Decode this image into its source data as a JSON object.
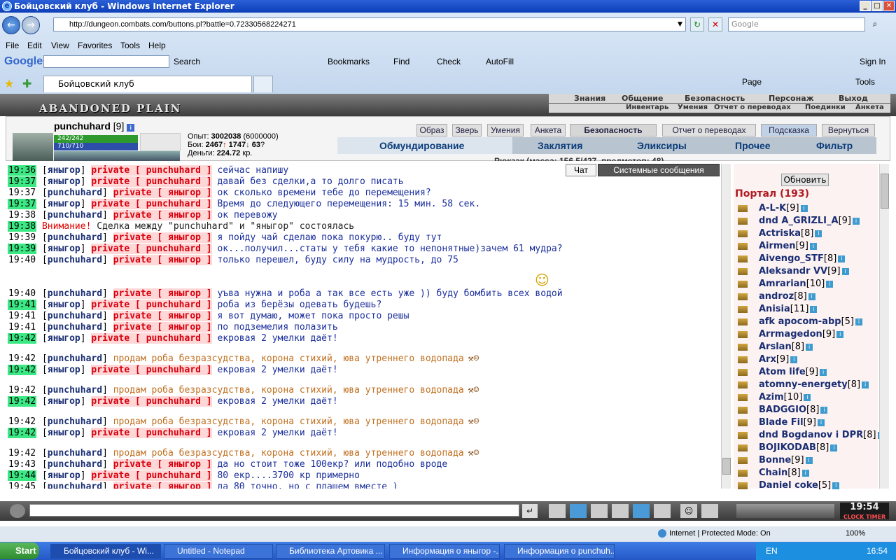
{
  "window": {
    "title": "Бойцовский клуб - Windows Internet Explorer"
  },
  "browser": {
    "address": "http://dungeon.combats.com/buttons.pl?battle=0.72330568224271",
    "search_placeholder": "Google",
    "menu": [
      "File",
      "Edit",
      "View",
      "Favorites",
      "Tools",
      "Help"
    ],
    "google_toolbar": {
      "logo": "Google",
      "search_label": "Search",
      "bookmarks": "Bookmarks",
      "find": "Find",
      "check": "Check",
      "autofill": "AutoFill",
      "signin": "Sign In"
    },
    "tab_title": "Бойцовский клуб",
    "cmd": {
      "page": "Page",
      "tools": "Tools"
    }
  },
  "game": {
    "location": "ABANDONED PLAIN",
    "top_nav1": [
      "Знания",
      "Общение",
      "Безопасность",
      "Персонаж",
      "Выход"
    ],
    "top_nav2": [
      "Инвентарь",
      "Умения",
      "Отчет о переводах",
      "Поединки",
      "Анкета"
    ],
    "character": {
      "name": "punchuhard",
      "level": "[9]",
      "hp": "242/242",
      "mana": "710/710"
    },
    "stats": {
      "exp_label": "Опыт:",
      "exp": "3002038",
      "exp_next": "(6000000)",
      "fights_label": "Бои:",
      "wins": "2467",
      "losses": "1747",
      "draws": "63",
      "money_label": "Деньги:",
      "money": "224.72",
      "money_unit": "кр."
    },
    "buttons": [
      "Образ",
      "Зверь",
      "Умения",
      "Анкета",
      "Безопасность",
      "Отчет о переводах",
      "Подсказка",
      "Вернуться"
    ],
    "inv_tabs": [
      "Обмундирование",
      "Заклятия",
      "Эликсиры",
      "Прочее",
      "Фильтр"
    ],
    "backpack": "Рюкзак (масса: 156.5/427, предметов: 48)",
    "chat_tabs": [
      "Чат",
      "Системные сообщения"
    ]
  },
  "chat": [
    {
      "time": "19:36",
      "hl": true,
      "name": "яныгор",
      "private": "punchuhard",
      "text": "сейчас напишу"
    },
    {
      "time": "19:37",
      "hl": true,
      "name": "яныгор",
      "private": "punchuhard",
      "text": "давай без сделки,а то долго писать"
    },
    {
      "time": "19:37",
      "hl": false,
      "name": "punchuhard",
      "private": "яныгор",
      "text": "ок сколько времени тебе до перемещения?"
    },
    {
      "time": "19:37",
      "hl": true,
      "name": "яныгор",
      "private": "punchuhard",
      "text": "Время до следующего перемещения: 15 мин. 58 сек."
    },
    {
      "time": "19:38",
      "hl": false,
      "name": "punchuhard",
      "private": "яныгор",
      "text": "ок перевожу"
    },
    {
      "time": "19:38",
      "hl": true,
      "warning": "Внимание!",
      "text": "Сделка между \"punchuhard\" и \"яныгор\" состоялась"
    },
    {
      "time": "19:39",
      "hl": false,
      "name": "punchuhard",
      "private": "яныгор",
      "text": "я пойду чай сделаю пока покурю.. буду тут"
    },
    {
      "time": "19:39",
      "hl": true,
      "name": "яныгор",
      "private": "punchuhard",
      "text": "ок...получил...статы у тебя какие то непонятные)зачем 61 мудра?"
    },
    {
      "time": "19:40",
      "hl": false,
      "name": "punchuhard",
      "private": "яныгор",
      "text": "только перешел, буду силу на мудрость, до 75"
    },
    {
      "time": "19:40",
      "hl": false,
      "name": "punchuhard",
      "private": "яныгор",
      "text": "уъва нужна и роба а так все есть уже )) буду бомбить всех водой"
    },
    {
      "time": "19:41",
      "hl": true,
      "name": "яныгор",
      "private": "punchuhard",
      "text": "роба из берёзы одевать будешь?"
    },
    {
      "time": "19:41",
      "hl": false,
      "name": "punchuhard",
      "private": "яныгор",
      "text": "я вот думаю, может пока просто решы"
    },
    {
      "time": "19:41",
      "hl": false,
      "name": "punchuhard",
      "private": "яныгор",
      "text": "по подземелия полазить"
    },
    {
      "time": "19:42",
      "hl": true,
      "name": "яныгор",
      "private": "punchuhard",
      "text": "екровая 2 умелки даёт!"
    },
    {
      "time": "19:42",
      "hl": false,
      "name": "punchuhard",
      "public": true,
      "text": "продам роба безразсудства, корона стихий, юва утреннего водопада"
    },
    {
      "time": "19:42",
      "hl": true,
      "name": "яныгор",
      "private": "punchuhard",
      "text": "екровая 2 умелки даёт!"
    },
    {
      "time": "19:42",
      "hl": false,
      "name": "punchuhard",
      "public": true,
      "text": "продам роба безразсудства, корона стихий, юва утреннего водопада"
    },
    {
      "time": "19:42",
      "hl": true,
      "name": "яныгор",
      "private": "punchuhard",
      "text": "екровая 2 умелки даёт!"
    },
    {
      "time": "19:42",
      "hl": false,
      "name": "punchuhard",
      "public": true,
      "text": "продам роба безразсудства, корона стихий, юва утреннего водопада"
    },
    {
      "time": "19:42",
      "hl": true,
      "name": "яныгор",
      "private": "punchuhard",
      "text": "екровая 2 умелки даёт!"
    },
    {
      "time": "19:42",
      "hl": false,
      "name": "punchuhard",
      "public": true,
      "text": "продам роба безразсудства, корона стихий, юва утреннего водопада"
    },
    {
      "time": "19:43",
      "hl": false,
      "name": "punchuhard",
      "private": "яныгор",
      "text": "да но стоит тоже 100екр? или подобно вроде"
    },
    {
      "time": "19:44",
      "hl": true,
      "name": "яныгор",
      "private": "punchuhard",
      "text": "80 екр....3700 кр примерно"
    },
    {
      "time": "19:45",
      "hl": false,
      "name": "punchuhard",
      "private": "яныгор",
      "text": "да 80 точно, но с плащем вместе )"
    }
  ],
  "private_label": "private",
  "users_panel": {
    "refresh": "Обновить",
    "room": "Портал (193)",
    "users": [
      {
        "name": "A-L-K",
        "level": "[9]"
      },
      {
        "name": "dnd A_GRIZLI_A",
        "level": "[9]"
      },
      {
        "name": "Actriska",
        "level": "[8]"
      },
      {
        "name": "Airmen",
        "level": "[9]"
      },
      {
        "name": "Aivengo_STF",
        "level": "[8]"
      },
      {
        "name": "Aleksandr VV",
        "level": "[9]"
      },
      {
        "name": "Amrarian",
        "level": "[10]"
      },
      {
        "name": "androz",
        "level": "[8]"
      },
      {
        "name": "Anisia",
        "level": "[11]"
      },
      {
        "name": "afk apocom-abp",
        "level": "[5]"
      },
      {
        "name": "Arrmagedon",
        "level": "[9]"
      },
      {
        "name": "Arslan",
        "level": "[8]"
      },
      {
        "name": "Arx",
        "level": "[9]"
      },
      {
        "name": "Atom life",
        "level": "[9]"
      },
      {
        "name": "atomny-energety",
        "level": "[8]"
      },
      {
        "name": "Azim",
        "level": "[10]"
      },
      {
        "name": "BADGGIO",
        "level": "[8]"
      },
      {
        "name": "Blade Fil",
        "level": "[9]"
      },
      {
        "name": "dnd Bogdanov i DPR",
        "level": "[8]"
      },
      {
        "name": "BOJIKODAB",
        "level": "[8]"
      },
      {
        "name": "Bonne",
        "level": "[9]"
      },
      {
        "name": "Chain",
        "level": "[8]"
      },
      {
        "name": "Daniel coke",
        "level": "[5]"
      }
    ]
  },
  "clock": {
    "time": "19:54",
    "labels": "CLOCK TIMER"
  },
  "statusbar": {
    "zone": "Internet | Protected Mode: On",
    "zoom": "100%"
  },
  "taskbar": {
    "start": "Start",
    "tasks": [
      "Бойцовский клуб - Wi...",
      "Untitled - Notepad",
      "Библиотека Артовика ...",
      "Информация о яныгор -...",
      "Информация о punchuh..."
    ],
    "lang": "EN",
    "time": "16:54"
  }
}
